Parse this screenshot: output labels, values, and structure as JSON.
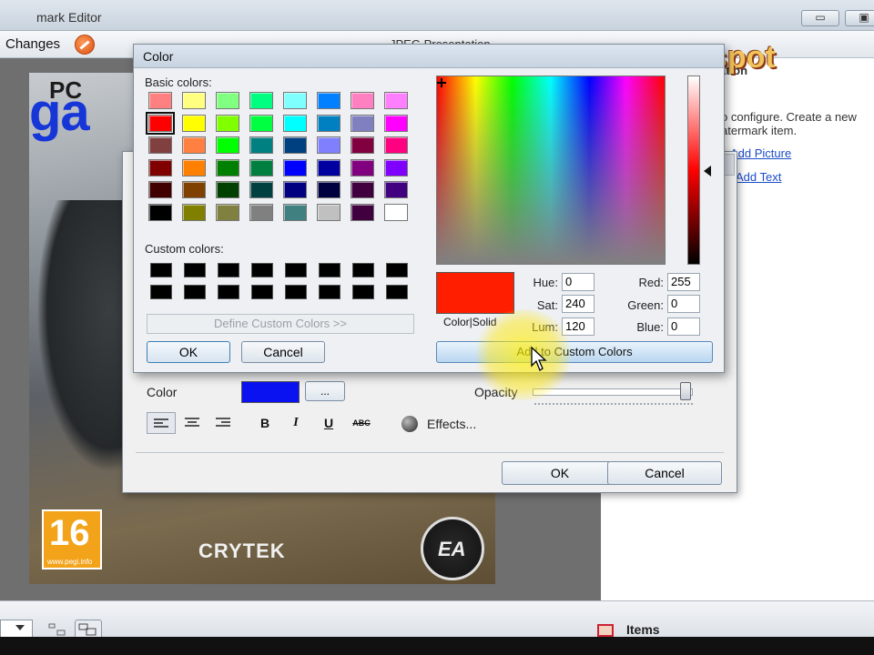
{
  "app": {
    "title": "mark Editor",
    "toolbar_changes": "Changes",
    "toolbar_jpeg": "JPEG Presentation",
    "min_glyph": "▭",
    "max_glyph": "▣"
  },
  "cover": {
    "pc": "PC",
    "ga": "ga",
    "pegi_num": "16",
    "pegi_url": "www.pegi.info",
    "crytek": "CRYTEK",
    "ea": "EA"
  },
  "watermark": {
    "text": "sctim.blogspot"
  },
  "right_panel": {
    "section_title": "ation",
    "description": "o configure. Create a new atermark item.",
    "link_picture": "Add Picture",
    "link_text": "Add Text"
  },
  "bottom_bar": {
    "items_label": "Items"
  },
  "edit_dialog": {
    "color_label": "Color",
    "color_value": "#0b12f2",
    "color_more_button": "...",
    "opacity_label": "Opacity",
    "opacity_value": 1.0,
    "bold": "B",
    "italic": "I",
    "underline": "U",
    "strike": "ABC",
    "effects_label": "Effects...",
    "ok_label": "OK",
    "cancel_label": "Cancel"
  },
  "color_dialog": {
    "title": "Color",
    "basic_colors_label": "Basic colors:",
    "basic_colors": [
      "#ff8080",
      "#ffff80",
      "#80ff80",
      "#00ff80",
      "#80ffff",
      "#0080ff",
      "#ff80c0",
      "#ff80ff",
      "#ff0000",
      "#ffff00",
      "#80ff00",
      "#00ff40",
      "#00ffff",
      "#0080c0",
      "#8080c0",
      "#ff00ff",
      "#804040",
      "#ff8040",
      "#00ff00",
      "#008080",
      "#004080",
      "#8080ff",
      "#800040",
      "#ff0080",
      "#800000",
      "#ff8000",
      "#008000",
      "#008040",
      "#0000ff",
      "#0000a0",
      "#800080",
      "#8000ff",
      "#400000",
      "#804000",
      "#004000",
      "#004040",
      "#000080",
      "#000040",
      "#400040",
      "#400080",
      "#000000",
      "#808000",
      "#808040",
      "#808080",
      "#408080",
      "#c0c0c0",
      "#400040",
      "#ffffff"
    ],
    "selected_basic_index": 8,
    "custom_colors_label": "Custom colors:",
    "custom_colors": [
      "#000000",
      "#000000",
      "#000000",
      "#000000",
      "#000000",
      "#000000",
      "#000000",
      "#000000",
      "#000000",
      "#000000",
      "#000000",
      "#000000",
      "#000000",
      "#000000",
      "#000000",
      "#000000"
    ],
    "define_custom_label": "Define Custom Colors >>",
    "ok_label": "OK",
    "cancel_label": "Cancel",
    "preview_color": "#ff1e00",
    "preview_label": "Color|Solid",
    "hue_label": "Hue:",
    "hue": "0",
    "sat_label": "Sat:",
    "sat": "240",
    "lum_label": "Lum:",
    "lum": "120",
    "red_label": "Red:",
    "red": "255",
    "green_label": "Green:",
    "green": "0",
    "blue_label": "Blue:",
    "blue": "0",
    "add_custom_label": "Add to Custom Colors"
  }
}
